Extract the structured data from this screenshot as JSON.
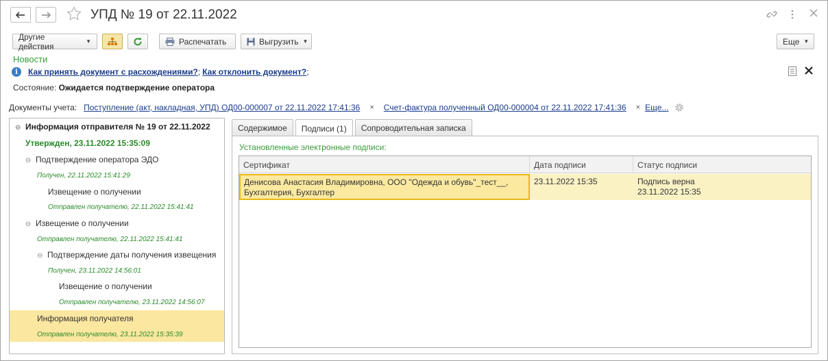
{
  "window": {
    "title": "УПД № 19 от 22.11.2022"
  },
  "icons": {
    "back": "arrow-left-icon",
    "forward": "arrow-right-icon",
    "favorite": "star-icon",
    "link": "link-icon",
    "menu": "more-vertical-icon",
    "close": "close-icon",
    "structure": "hierarchy-icon",
    "refresh": "refresh-icon",
    "print": "printer-icon",
    "export": "floppy-disk-icon",
    "info": "info-icon",
    "note": "note-icon",
    "settings": "gear-icon"
  },
  "toolbar": {
    "other_actions": "Другие действия",
    "print": "Распечатать",
    "export": "Выгрузить",
    "more": "Еще"
  },
  "news": {
    "label": "Новости",
    "link1": "Как принять документ с расхождениями?",
    "sep": ";",
    "link2": "Как отклонить документ?",
    "end": ";"
  },
  "state": {
    "label": "Состояние:",
    "value": "Ожидается подтверждение оператора"
  },
  "docs": {
    "label": "Документы учета:",
    "doc1": "Поступление (акт, накладная, УПД) ОД00-000007 от 22.11.2022 17:41:36",
    "doc2": "Счет-фактура полученный ОД00-000004 от 22.11.2022 17:41:36",
    "more": "Еще...",
    "remove": "×"
  },
  "tree": [
    {
      "text": "Информация отправителя № 19 от 22.11.2022",
      "kind": "header",
      "toggle": "⊖"
    },
    {
      "text": "Утвержден, 23.11.2022 15:35:09",
      "kind": "approved"
    },
    {
      "text": "Подтверждение оператора ЭДО",
      "kind": "main",
      "toggle": "⊖"
    },
    {
      "text": "Получен, 22.11.2022 15:41:29",
      "kind": "status"
    },
    {
      "text": "Извещение о получении",
      "kind": "main"
    },
    {
      "text": "Отправлен получателю, 22.11.2022 15:41:41",
      "kind": "status"
    },
    {
      "text": "Извещение о получении",
      "kind": "main",
      "toggle": "⊖"
    },
    {
      "text": "Отправлен получателю, 22.11.2022 15:41:41",
      "kind": "status"
    },
    {
      "text": "Подтверждение даты получения извещения",
      "kind": "main",
      "toggle": "⊖"
    },
    {
      "text": "Получен, 23.11.2022 14:56:01",
      "kind": "status"
    },
    {
      "text": "Извещение о получении",
      "kind": "main"
    },
    {
      "text": "Отправлен получателю, 23.11.2022 14:56:07",
      "kind": "status"
    },
    {
      "text": "Информация получателя",
      "kind": "main"
    },
    {
      "text": "Отправлен получателю, 23.11.2022 15:35:39",
      "kind": "status"
    }
  ],
  "tabs": [
    "Содержимое",
    "Подписи (1)",
    "Сопроводительная записка"
  ],
  "signatures": {
    "caption": "Установленные электронные подписи:",
    "columns": [
      "Сертификат",
      "Дата подписи",
      "Статус подписи"
    ],
    "rows": [
      {
        "certificate_line1": "Денисова Анастасия Владимировна, ООО \"Одежда и обувь\"_тест__,",
        "certificate_line2": "Бухгалтерия, Бухгалтер",
        "date": "23.11.2022 15:35",
        "status_line1": "Подпись верна",
        "status_line2": "23.11.2022 15:35"
      }
    ]
  }
}
